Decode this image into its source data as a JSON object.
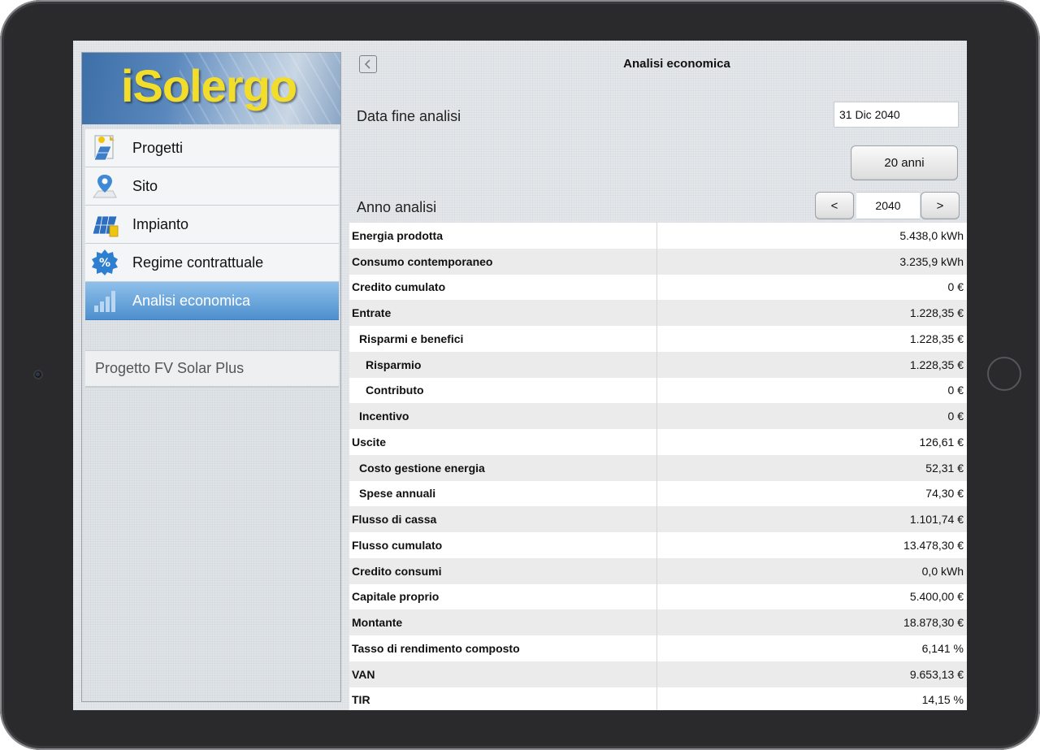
{
  "app": {
    "logo_text": "iSolergo"
  },
  "sidebar": {
    "items": [
      {
        "label": "Progetti",
        "icon": "projects-icon"
      },
      {
        "label": "Sito",
        "icon": "map-pin-icon"
      },
      {
        "label": "Impianto",
        "icon": "solar-panel-icon"
      },
      {
        "label": "Regime contrattuale",
        "icon": "percent-badge-icon"
      },
      {
        "label": "Analisi economica",
        "icon": "bar-chart-icon",
        "active": true
      }
    ],
    "project_name": "Progetto FV Solar Plus"
  },
  "header": {
    "title": "Analisi economica",
    "back_icon": "chevron-left-icon"
  },
  "form": {
    "end_date_label": "Data fine analisi",
    "end_date_value": "31 Dic 2040",
    "years_button": "20 anni",
    "year_label": "Anno analisi",
    "year_value": "2040",
    "prev_label": "<",
    "next_label": ">"
  },
  "table": {
    "rows": [
      {
        "label": "Energia prodotta",
        "value": "5.438,0 kWh",
        "indent": 0
      },
      {
        "label": "Consumo contemporaneo",
        "value": "3.235,9 kWh",
        "indent": 0
      },
      {
        "label": "Credito cumulato",
        "value": "0 €",
        "indent": 0
      },
      {
        "label": "Entrate",
        "value": "1.228,35 €",
        "indent": 0
      },
      {
        "label": "Risparmi e benefici",
        "value": "1.228,35 €",
        "indent": 1
      },
      {
        "label": "Risparmio",
        "value": "1.228,35 €",
        "indent": 2
      },
      {
        "label": "Contributo",
        "value": "0 €",
        "indent": 2
      },
      {
        "label": "Incentivo",
        "value": "0 €",
        "indent": 1
      },
      {
        "label": "Uscite",
        "value": "126,61 €",
        "indent": 0
      },
      {
        "label": "Costo gestione energia",
        "value": "52,31 €",
        "indent": 1
      },
      {
        "label": "Spese annuali",
        "value": "74,30 €",
        "indent": 1
      },
      {
        "label": "Flusso di cassa",
        "value": "1.101,74 €",
        "indent": 0
      },
      {
        "label": "Flusso cumulato",
        "value": "13.478,30 €",
        "indent": 0
      },
      {
        "label": "Credito consumi",
        "value": "0,0 kWh",
        "indent": 0
      },
      {
        "label": "Capitale proprio",
        "value": "5.400,00 €",
        "indent": 0
      },
      {
        "label": "Montante",
        "value": "18.878,30 €",
        "indent": 0
      },
      {
        "label": "Tasso di rendimento composto",
        "value": "6,141 %",
        "indent": 0
      },
      {
        "label": "VAN",
        "value": "9.653,13 €",
        "indent": 0
      },
      {
        "label": "TIR",
        "value": "14,15 %",
        "indent": 0
      }
    ]
  },
  "colors": {
    "active_nav": "#5a9ad6",
    "logo_text": "#f2dd2a"
  }
}
